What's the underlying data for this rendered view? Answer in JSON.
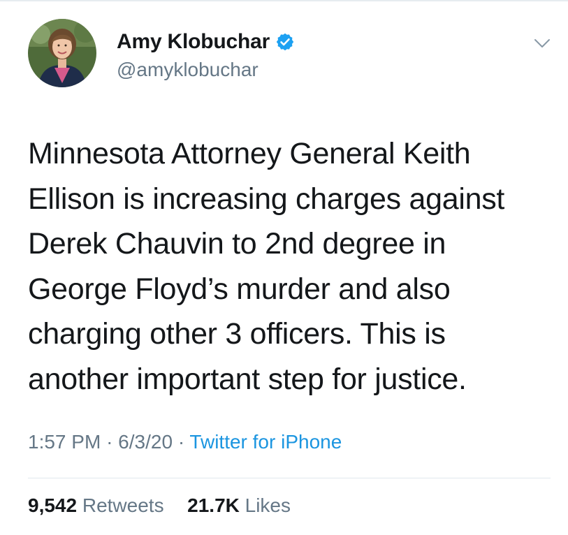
{
  "author": {
    "display_name": "Amy Klobuchar",
    "handle": "@amyklobuchar",
    "verified": true
  },
  "tweet": {
    "lines": [
      "Minnesota Attorney General Keith",
      "Ellison is increasing charges against",
      "Derek Chauvin to 2nd degree in",
      "George Floyd’s murder and also",
      "charging other 3 officers. This is",
      "another important step for justice."
    ]
  },
  "meta": {
    "time": "1:57 PM",
    "separator": "·",
    "date": "6/3/20",
    "source": "Twitter for iPhone"
  },
  "stats": {
    "retweets_count": "9,542",
    "retweets_label": "Retweets",
    "likes_count": "21.7K",
    "likes_label": "Likes"
  },
  "icons": {
    "verified": "verified-badge-icon",
    "caret": "chevron-down-icon"
  },
  "colors": {
    "text": "#14171a",
    "secondary": "#657786",
    "link": "#1b95e0",
    "verified": "#1da1f2"
  }
}
